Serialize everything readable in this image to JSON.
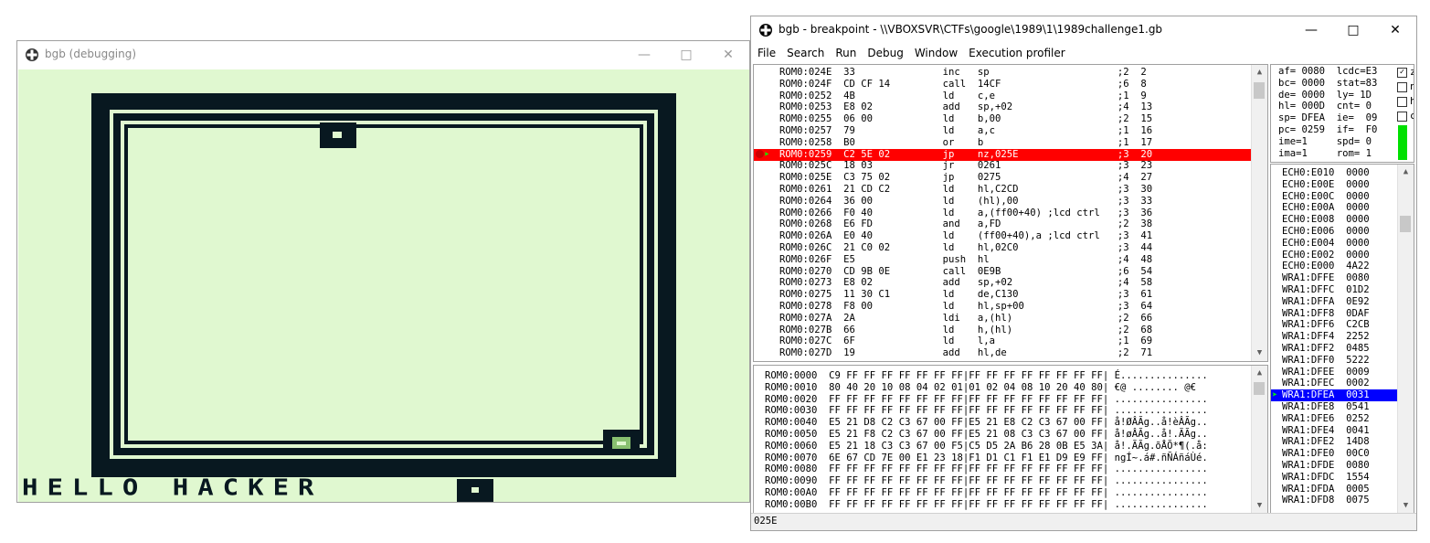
{
  "colors": {
    "gb_bg": "#e0f8d0",
    "gb_dark": "#081820",
    "gb_mid": "#88c070",
    "highlight_red": "#ff0000",
    "highlight_blue": "#0000ff",
    "green_indicator": "#00e000"
  },
  "emulator_window": {
    "title": "bgb (debugging)",
    "minimize_icon": "minimize-icon",
    "maximize_icon": "maximize-icon",
    "close_icon": "close-icon",
    "screen_text": "HELLO HACKER"
  },
  "debugger_window": {
    "title": "bgb - breakpoint - \\\\VBOXSVR\\CTFs\\google\\1989\\1\\1989challenge1.gb",
    "menu": [
      "File",
      "Search",
      "Run",
      "Debug",
      "Window",
      "Execution profiler"
    ],
    "disassembly": [
      {
        "addr": "ROM0:024E",
        "bytes": "33",
        "mnem": "inc",
        "ops": "sp",
        "cyc": ";2",
        "total": "2"
      },
      {
        "addr": "ROM0:024F",
        "bytes": "CD CF 14",
        "mnem": "call",
        "ops": "14CF",
        "cyc": ";6",
        "total": "8"
      },
      {
        "addr": "ROM0:0252",
        "bytes": "4B",
        "mnem": "ld",
        "ops": "c,e",
        "cyc": ";1",
        "total": "9"
      },
      {
        "addr": "ROM0:0253",
        "bytes": "E8 02",
        "mnem": "add",
        "ops": "sp,+02",
        "cyc": ";4",
        "total": "13"
      },
      {
        "addr": "ROM0:0255",
        "bytes": "06 00",
        "mnem": "ld",
        "ops": "b,00",
        "cyc": ";2",
        "total": "15"
      },
      {
        "addr": "ROM0:0257",
        "bytes": "79",
        "mnem": "ld",
        "ops": "a,c",
        "cyc": ";1",
        "total": "16"
      },
      {
        "addr": "ROM0:0258",
        "bytes": "B0",
        "mnem": "or",
        "ops": "b",
        "cyc": ";1",
        "total": "17"
      },
      {
        "addr": "ROM0:0259",
        "bytes": "C2 5E 02",
        "mnem": "jp",
        "ops": "nz,025E",
        "cyc": ";3",
        "total": "20",
        "current": true
      },
      {
        "addr": "ROM0:025C",
        "bytes": "18 03",
        "mnem": "jr",
        "ops": "0261",
        "cyc": ";3",
        "total": "23"
      },
      {
        "addr": "ROM0:025E",
        "bytes": "C3 75 02",
        "mnem": "jp",
        "ops": "0275",
        "cyc": ";4",
        "total": "27"
      },
      {
        "addr": "ROM0:0261",
        "bytes": "21 CD C2",
        "mnem": "ld",
        "ops": "hl,C2CD",
        "cyc": ";3",
        "total": "30"
      },
      {
        "addr": "ROM0:0264",
        "bytes": "36 00",
        "mnem": "ld",
        "ops": "(hl),00",
        "cyc": ";3",
        "total": "33"
      },
      {
        "addr": "ROM0:0266",
        "bytes": "F0 40",
        "mnem": "ld",
        "ops": "a,(ff00+40) ;lcd ctrl",
        "cyc": ";3",
        "total": "36"
      },
      {
        "addr": "ROM0:0268",
        "bytes": "E6 FD",
        "mnem": "and",
        "ops": "a,FD",
        "cyc": ";2",
        "total": "38"
      },
      {
        "addr": "ROM0:026A",
        "bytes": "E0 40",
        "mnem": "ld",
        "ops": "(ff00+40),a ;lcd ctrl",
        "cyc": ";3",
        "total": "41"
      },
      {
        "addr": "ROM0:026C",
        "bytes": "21 C0 02",
        "mnem": "ld",
        "ops": "hl,02C0",
        "cyc": ";3",
        "total": "44"
      },
      {
        "addr": "ROM0:026F",
        "bytes": "E5",
        "mnem": "push",
        "ops": "hl",
        "cyc": ";4",
        "total": "48"
      },
      {
        "addr": "ROM0:0270",
        "bytes": "CD 9B 0E",
        "mnem": "call",
        "ops": "0E9B",
        "cyc": ";6",
        "total": "54"
      },
      {
        "addr": "ROM0:0273",
        "bytes": "E8 02",
        "mnem": "add",
        "ops": "sp,+02",
        "cyc": ";4",
        "total": "58"
      },
      {
        "addr": "ROM0:0275",
        "bytes": "11 30 C1",
        "mnem": "ld",
        "ops": "de,C130",
        "cyc": ";3",
        "total": "61"
      },
      {
        "addr": "ROM0:0278",
        "bytes": "F8 00",
        "mnem": "ld",
        "ops": "hl,sp+00",
        "cyc": ";3",
        "total": "64"
      },
      {
        "addr": "ROM0:027A",
        "bytes": "2A",
        "mnem": "ldi",
        "ops": "a,(hl)",
        "cyc": ";2",
        "total": "66"
      },
      {
        "addr": "ROM0:027B",
        "bytes": "66",
        "mnem": "ld",
        "ops": "h,(hl)",
        "cyc": ";2",
        "total": "68"
      },
      {
        "addr": "ROM0:027C",
        "bytes": "6F",
        "mnem": "ld",
        "ops": "l,a",
        "cyc": ";1",
        "total": "69"
      },
      {
        "addr": "ROM0:027D",
        "bytes": "19",
        "mnem": "add",
        "ops": "hl,de",
        "cyc": ";2",
        "total": "71"
      }
    ],
    "registers": [
      "af= 0080  lcdc=E3",
      "bc= 0000  stat=83",
      "de= 0000  ly= 1D",
      "hl= 000D  cnt= 0",
      "sp= DFEA  ie=  09",
      "pc= 0259  if=  F0",
      "ime=1     spd= 0",
      "ima=1     rom= 1"
    ],
    "flags": [
      {
        "label": "z",
        "checked": true
      },
      {
        "label": "n",
        "checked": false
      },
      {
        "label": "h",
        "checked": false
      },
      {
        "label": "c",
        "checked": false
      }
    ],
    "stack": [
      "ECH0:E010  0000",
      "ECH0:E00E  0000",
      "ECH0:E00C  0000",
      "ECH0:E00A  0000",
      "ECH0:E008  0000",
      "ECH0:E006  0000",
      "ECH0:E004  0000",
      "ECH0:E002  0000",
      "ECH0:E000  4A22",
      "WRA1:DFFE  0080",
      "WRA1:DFFC  01D2",
      "WRA1:DFFA  0E92",
      "WRA1:DFF8  0DAF",
      "WRA1:DFF6  C2CB",
      "WRA1:DFF4  2252",
      "WRA1:DFF2  0485",
      "WRA1:DFF0  5222",
      "WRA1:DFEE  0009",
      "WRA1:DFEC  0002",
      "WRA1:DFEA  0031",
      "WRA1:DFE8  0541",
      "WRA1:DFE6  0252",
      "WRA1:DFE4  0041",
      "WRA1:DFE2  14D8",
      "WRA1:DFE0  00C0",
      "WRA1:DFDE  0080",
      "WRA1:DFDC  1554",
      "WRA1:DFDA  0005",
      "WRA1:DFD8  0075"
    ],
    "stack_current_index": 19,
    "memory": [
      "ROM0:0000  C9 FF FF FF FF FF FF FF|FF FF FF FF FF FF FF FF| É...............",
      "ROM0:0010  80 40 20 10 08 04 02 01|01 02 04 08 10 20 40 80| €@ ........ @€",
      "ROM0:0020  FF FF FF FF FF FF FF FF|FF FF FF FF FF FF FF FF| ................",
      "ROM0:0030  FF FF FF FF FF FF FF FF|FF FF FF FF FF FF FF FF| ................",
      "ROM0:0040  E5 21 D8 C2 C3 67 00 FF|E5 21 E8 C2 C3 67 00 FF| å!ØÂÃg..å!èÂÃg..",
      "ROM0:0050  E5 21 F8 C2 C3 67 00 FF|E5 21 08 C3 C3 67 00 FF| å!øÂÃg..å!.ÃÃg..",
      "ROM0:0060  E5 21 18 C3 C3 67 00 F5|C5 D5 2A B6 28 0B E5 3A| å!.ÃÃg.õÅÕ*¶(.å:",
      "ROM0:0070  6E 67 CD 7E 00 E1 23 18|F1 D1 C1 F1 E1 D9 E9 FF| ngÍ~.á#.ñÑÁñáÙé.",
      "ROM0:0080  FF FF FF FF FF FF FF FF|FF FF FF FF FF FF FF FF| ................",
      "ROM0:0090  FF FF FF FF FF FF FF FF|FF FF FF FF FF FF FF FF| ................",
      "ROM0:00A0  FF FF FF FF FF FF FF FF|FF FF FF FF FF FF FF FF| ................",
      "ROM0:00B0  FF FF FF FF FF FF FF FF|FF FF FF FF FF FF FF FF| ................"
    ],
    "status": "025E"
  }
}
